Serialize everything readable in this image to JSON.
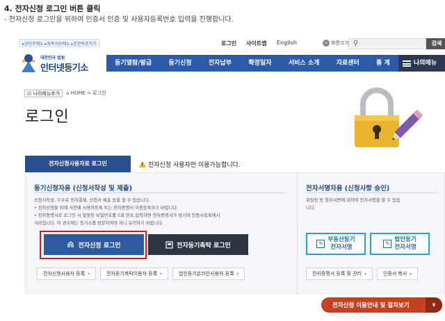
{
  "instruction": {
    "title": "4. 전자신청 로그인 버튼 클릭",
    "desc": "- 전자신청 로그인을 위하여 인증서 인증 및 사용자등록번호 입력을 진행합니다."
  },
  "topbar": {
    "skip": "▸상단주메뉴 ▸좌측서브메뉴 ▸본문바로가기",
    "login": "로그인",
    "sitemap": "사이트맵",
    "english": "English",
    "zoom_label": "화면크기",
    "zoom_minus": "−",
    "zoom_plus": "+",
    "search_placeholder": "",
    "search_button": "검색"
  },
  "logo": {
    "sub": "대한민국 법원",
    "main": "인터넷등기소"
  },
  "nav": {
    "items": [
      {
        "label": "등기열람/발급"
      },
      {
        "label": "등기신청"
      },
      {
        "label": "전자납부"
      },
      {
        "label": "확정일자"
      },
      {
        "label": "서비스 소개"
      },
      {
        "label": "자료센터"
      },
      {
        "label": "통 계"
      }
    ],
    "mymenu": "나의메뉴"
  },
  "breadcrumb": {
    "add": "나의메뉴추가",
    "path": "HOME > 로그인"
  },
  "page_title": "로그인",
  "tabs": {
    "active": "전자신청사용자로 로그인",
    "notice": "전자신청 사용자만 이용가능합니다."
  },
  "left_panel": {
    "heading": "등기신청자용 (신청서작성 및 제출)",
    "desc": [
      "신청서작성, 수수료 전자결제, 신청서 제출 등을 할 수 있습니다.",
      "• 전자신청을 위해 사전에 사용자등록 또는 전자증명서 이용등록하기 바랍니다.",
      "• 전자증명서로 로그인 시 잘못된 비밀번호를 5회 연속 입력하면 전자증명서가 잠기며 인증서목록에서",
      "  사라집니다. 이 경우에는 등기소를 방문하여야 하니 유의하기 바랍니다."
    ],
    "cert_login": "전자신청 로그인",
    "trust_login": "전자등기촉탁 로그인",
    "footer": [
      {
        "label": "전자신청사용자 등록"
      },
      {
        "label": "전자등기촉탁이용자 등록"
      },
      {
        "label": "법인등기온라인사용자 등록"
      }
    ]
  },
  "right_panel": {
    "heading": "전자서명자용 (신청사항 승인)",
    "desc": [
      "위임장 등 첨부서면에 대하여 전자서명을 할 수 있습",
      "니다."
    ],
    "realty_line1": "부동산등기",
    "realty_line2": "전자서명",
    "corp_line1": "법인등기",
    "corp_line2": "전자서명",
    "footer": [
      {
        "label": "전자증명서 등록 및 관리"
      },
      {
        "label": "인증서 복사"
      }
    ]
  },
  "guide": {
    "label": "전자신청 이용안내 및 절차보기",
    "toggle": "∨"
  },
  "colors": {
    "nav_blue": "#2a5ba8",
    "tab_navy": "#2a4f8f",
    "cert_button": "#2d5ba0",
    "trust_button": "#2e3440",
    "highlight": "#e0151b",
    "guide": "#c4421f",
    "sign_border": "#2ba1c7"
  }
}
